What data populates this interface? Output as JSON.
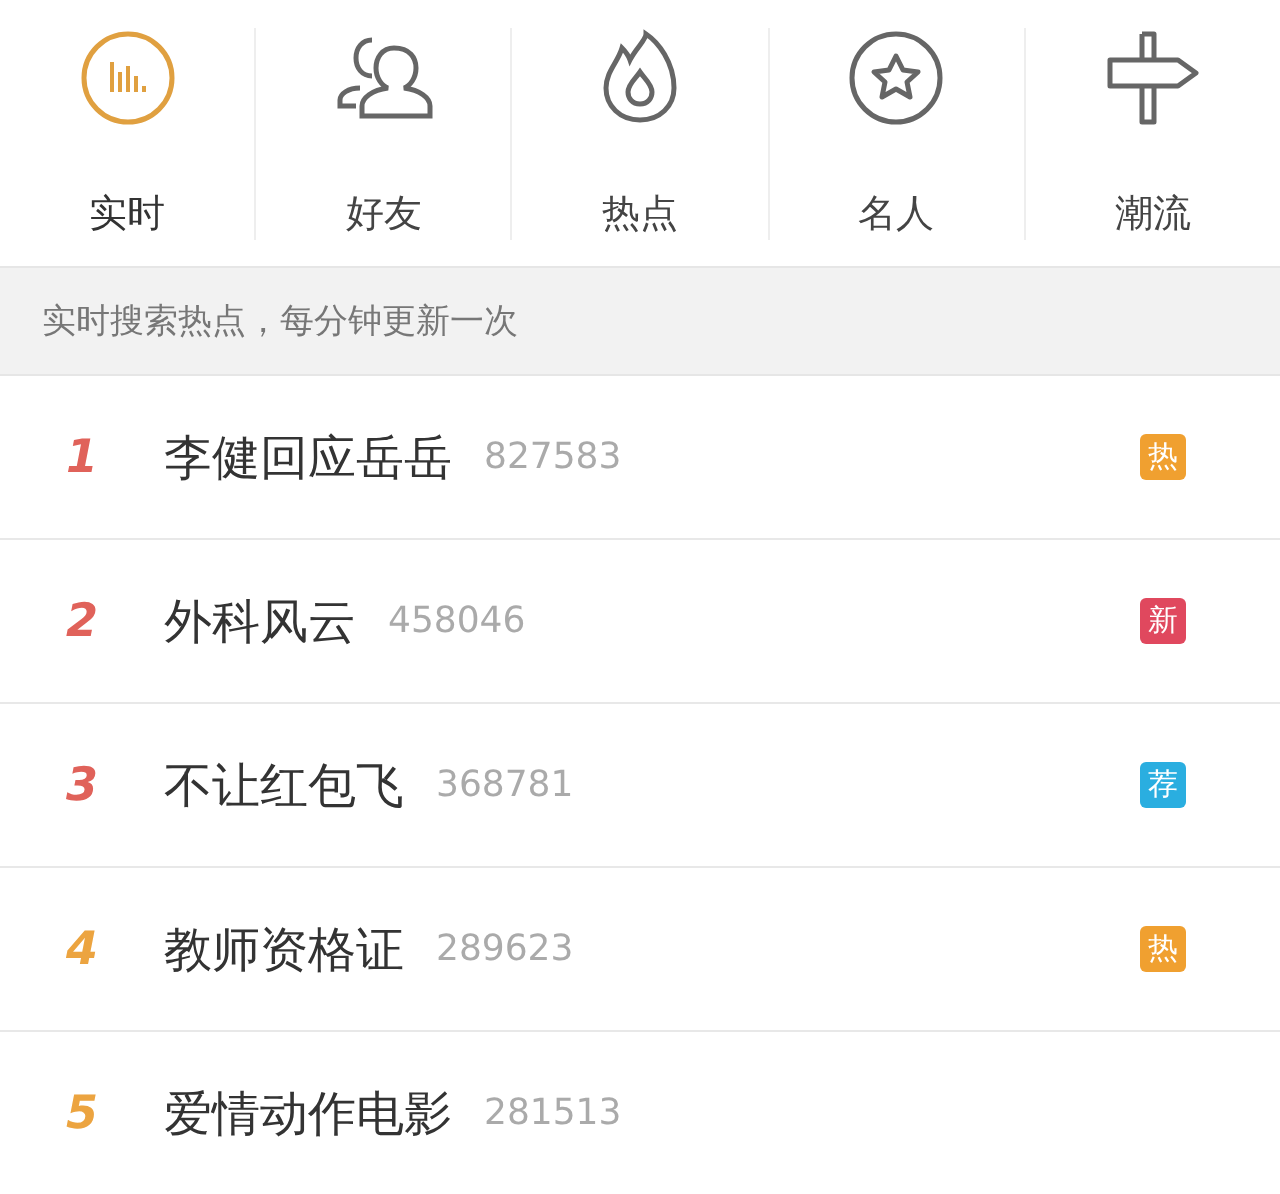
{
  "tabs": [
    {
      "label": "实时",
      "selected": true
    },
    {
      "label": "好友",
      "selected": false
    },
    {
      "label": "热点",
      "selected": false
    },
    {
      "label": "名人",
      "selected": false
    },
    {
      "label": "潮流",
      "selected": false
    }
  ],
  "caption": "实时搜索热点，每分钟更新一次",
  "rows": [
    {
      "rank": "1",
      "color": "#e0625a",
      "title": "李健回应岳岳",
      "count": "827583",
      "badge": {
        "text": "热",
        "color": "#f0a030"
      }
    },
    {
      "rank": "2",
      "color": "#e0625a",
      "title": "外科风云",
      "count": "458046",
      "badge": {
        "text": "新",
        "color": "#e0485e"
      }
    },
    {
      "rank": "3",
      "color": "#e0625a",
      "title": "不让红包飞",
      "count": "368781",
      "badge": {
        "text": "荐",
        "color": "#2aaee0"
      }
    },
    {
      "rank": "4",
      "color": "#eca440",
      "title": "教师资格证",
      "count": "289623",
      "badge": {
        "text": "热",
        "color": "#f0a030"
      }
    },
    {
      "rank": "5",
      "color": "#eca440",
      "title": "爱情动作电影",
      "count": "281513"
    }
  ]
}
